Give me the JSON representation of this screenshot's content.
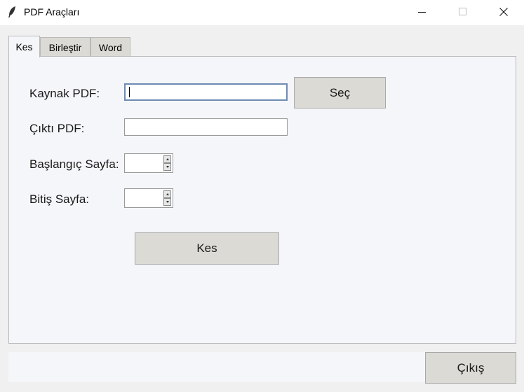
{
  "window": {
    "title": "PDF Araçları",
    "icon": "feather-icon",
    "controls": [
      "minimize-icon",
      "maximize-icon",
      "close-icon"
    ]
  },
  "tabs": [
    {
      "label": "Kes",
      "active": true
    },
    {
      "label": "Birleştir",
      "active": false
    },
    {
      "label": "Word",
      "active": false
    }
  ],
  "kes_tab": {
    "source_label": "Kaynak PDF:",
    "source_value": "",
    "select_button": "Seç",
    "output_label": "Çıktı PDF:",
    "output_value": "",
    "start_label": "Başlangıç Sayfa:",
    "start_value": "",
    "end_label": "Bitiş Sayfa:",
    "end_value": "",
    "cut_button": "Kes"
  },
  "footer": {
    "exit_button": "Çıkış"
  }
}
